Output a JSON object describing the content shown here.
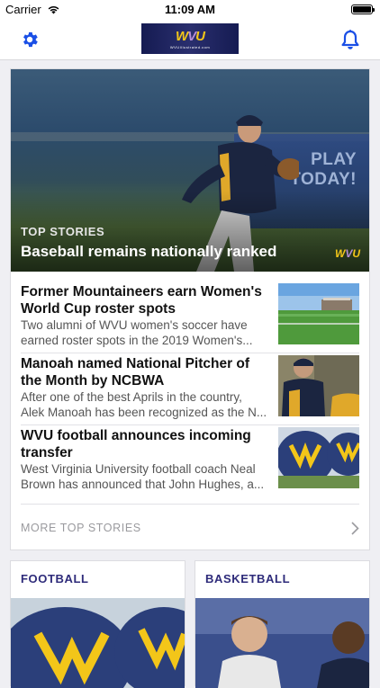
{
  "status_bar": {
    "carrier": "Carrier",
    "time": "11:09 AM"
  },
  "nav": {
    "logo_text": "WVU",
    "logo_sub": "WVUIllustrated.com",
    "settings_icon": "gear-icon",
    "notifications_icon": "bell-icon"
  },
  "hero": {
    "kicker": "TOP STORIES",
    "title": "Baseball remains nationally ranked",
    "board_text": "PLAY\nTODAY!"
  },
  "stories": [
    {
      "title": "Former Mountaineers earn Women's World Cup roster spots",
      "desc_line1": "Two alumni of WVU women's soccer have",
      "desc_line2": "earned roster spots in the 2019 Women's..."
    },
    {
      "title": "Manoah named National Pitcher of the Month by NCBWA",
      "desc_line1": "After one of the best Aprils in the country,",
      "desc_line2": "Alek Manoah has been recognized as the N..."
    },
    {
      "title": "WVU football announces incoming transfer",
      "desc_line1": "West Virginia University football coach Neal",
      "desc_line2": "Brown has announced that John Hughes, a..."
    }
  ],
  "more_top_stories": "MORE TOP STORIES",
  "sections": [
    {
      "title": "FOOTBALL"
    },
    {
      "title": "BASKETBALL"
    }
  ],
  "colors": {
    "brand_navy": "#2e2b7a",
    "brand_gold": "#f3c619",
    "accent_blue": "#1a4fe6"
  }
}
